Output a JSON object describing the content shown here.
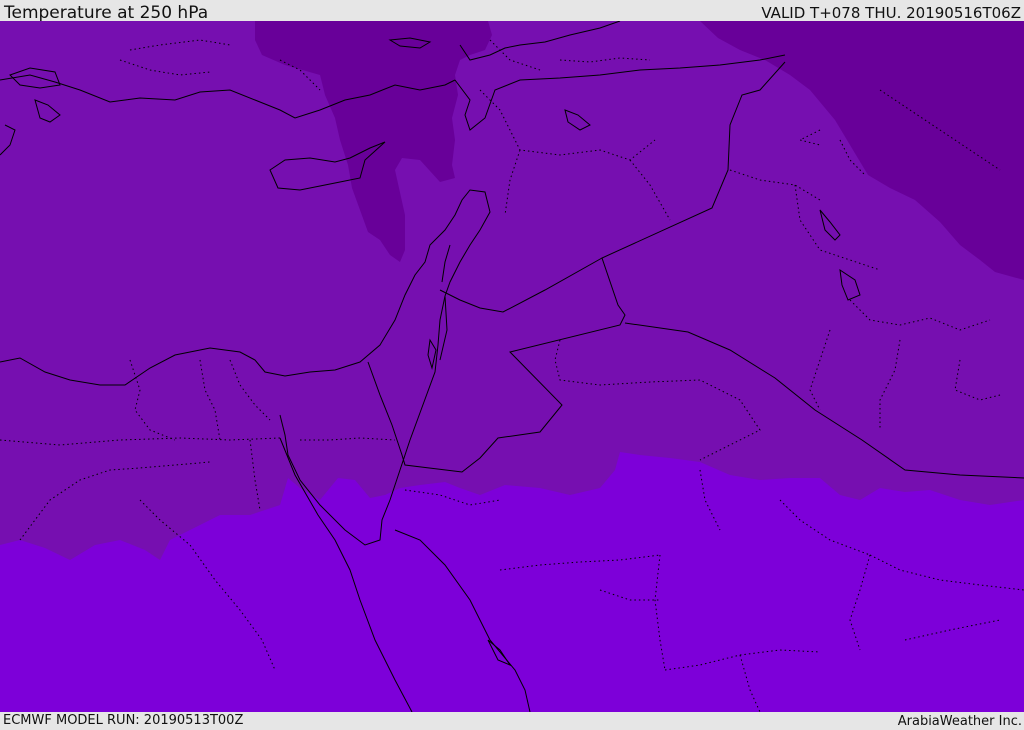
{
  "header": {
    "title": "Temperature at 250 hPa",
    "valid_time": "VALID T+078 THU. 20190516T06Z"
  },
  "footer": {
    "model_run": "ECMWF MODEL RUN: 20190513T00Z",
    "credit": "ArabiaWeather Inc."
  },
  "colors": {
    "band_cold": "#680099",
    "band_mid": "#760fb0",
    "band_warm": "#7d00d9",
    "coastline": "#000000",
    "frame": "#e6e6e6"
  }
}
